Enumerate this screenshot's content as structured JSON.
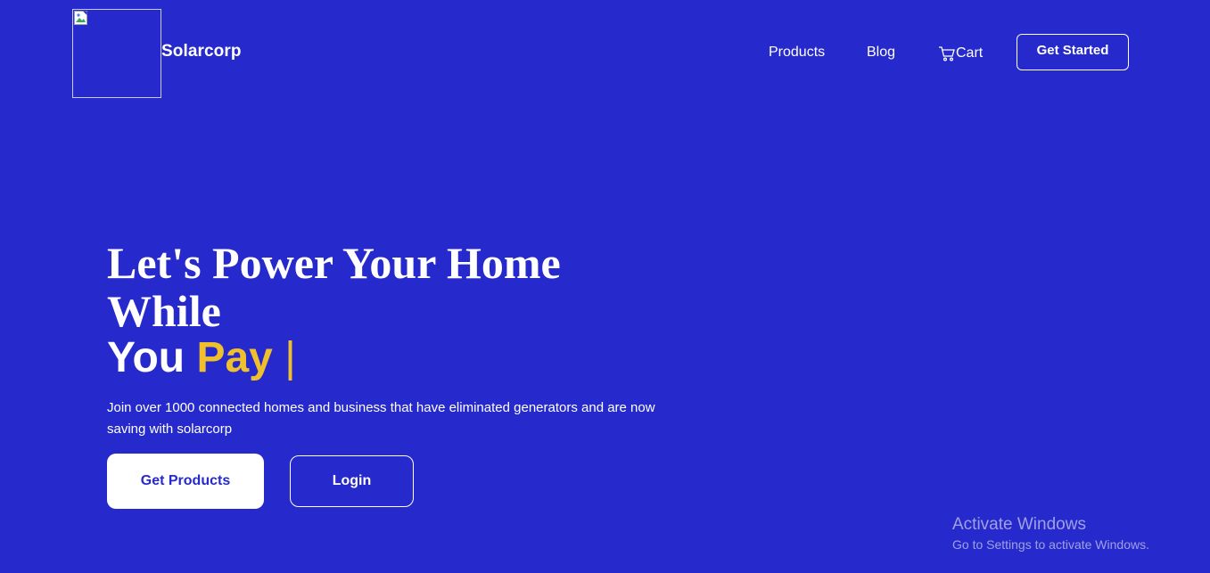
{
  "header": {
    "logo_icon": "broken-image-icon",
    "brand": "Solarcorp",
    "nav": {
      "products": "Products",
      "blog": "Blog",
      "cart": "Cart",
      "cart_icon": "cart-icon"
    },
    "get_started": "Get Started"
  },
  "hero": {
    "title": "Let's Power Your Home While",
    "line2_prefix": "You",
    "line2_accent": "Pay",
    "cursor": "|",
    "subtitle": "Join over 1000 connected homes and business that have eliminated generators and are now saving with solarcorp",
    "primary_button": "Get Products",
    "secondary_button": "Login"
  },
  "watermark": {
    "title": "Activate Windows",
    "subtitle": "Go to Settings to activate Windows."
  },
  "colors": {
    "background": "#2629cc",
    "accent": "#f0c02c",
    "text": "#ffffff"
  }
}
